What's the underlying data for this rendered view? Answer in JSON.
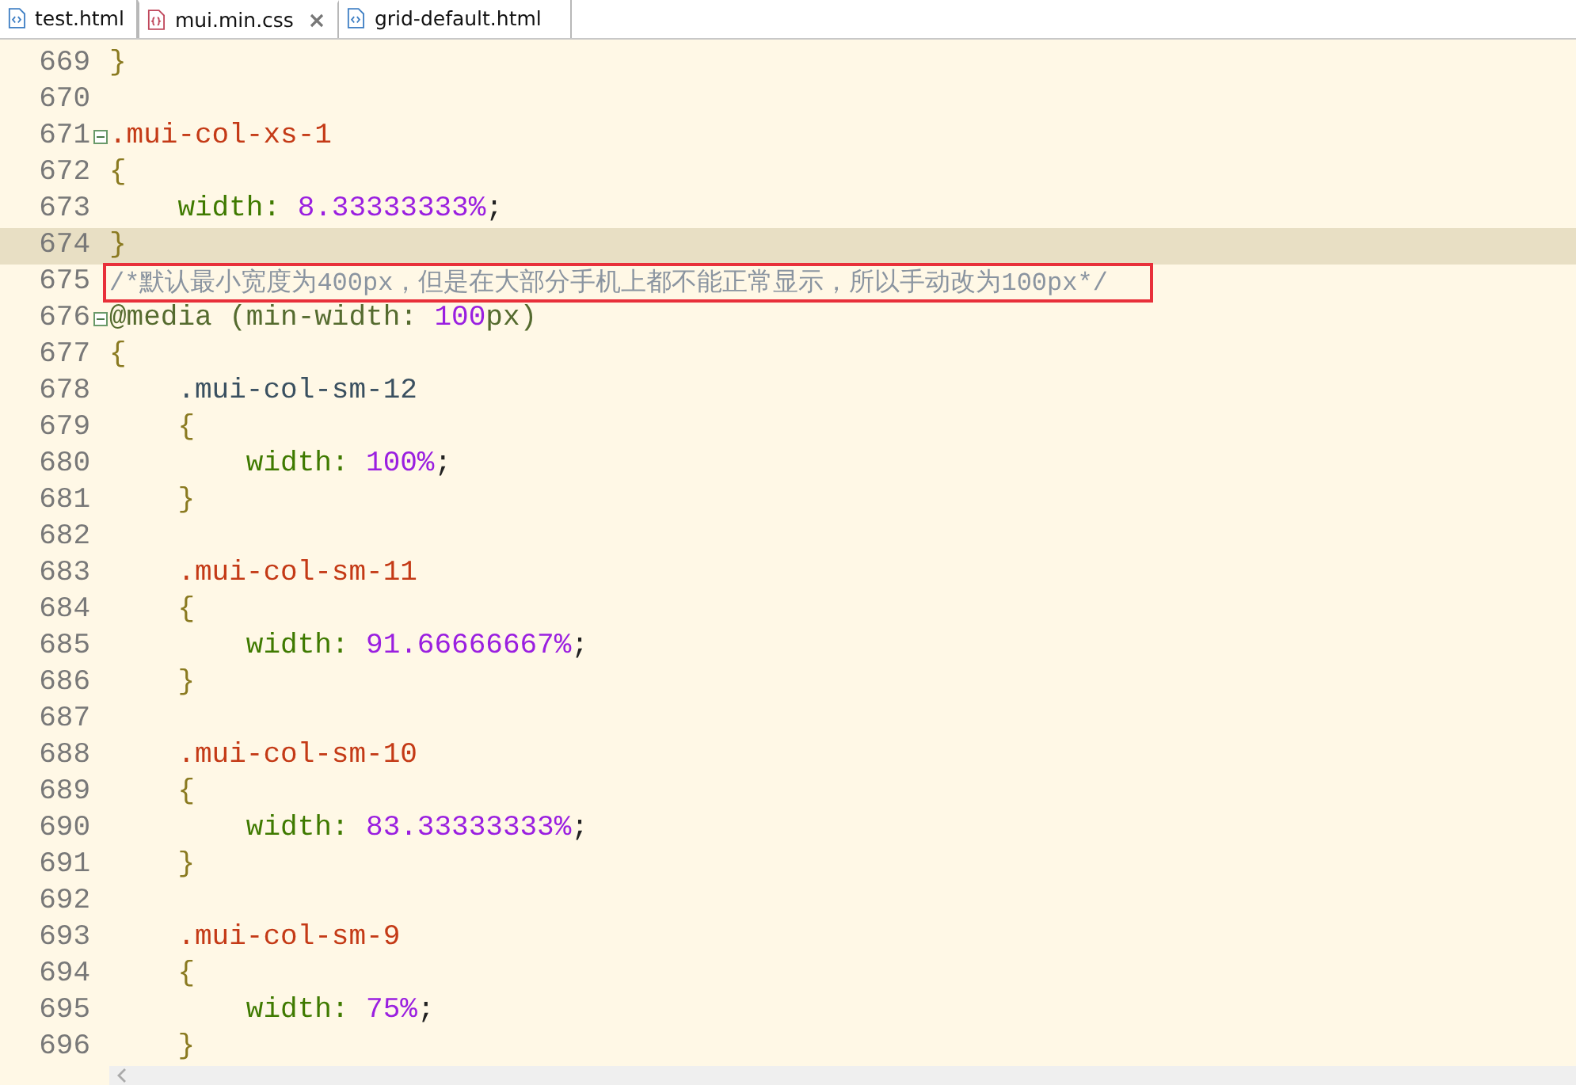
{
  "tabs": [
    {
      "label": "test.html",
      "kind": "html",
      "selected": false,
      "closable": false
    },
    {
      "label": "mui.min.css",
      "kind": "css",
      "selected": true,
      "closable": true
    },
    {
      "label": "grid-default.html",
      "kind": "html",
      "selected": false,
      "closable": false
    }
  ],
  "lines": [
    {
      "number": "669",
      "current": false,
      "fold": false,
      "annotated": false,
      "tokens": [
        {
          "kind": "brace",
          "text": "}"
        }
      ]
    },
    {
      "number": "670",
      "current": false,
      "fold": false,
      "annotated": false
    },
    {
      "number": "671",
      "current": false,
      "fold": true,
      "annotated": false,
      "tokens": [
        {
          "kind": "selector",
          "text": ".mui-col-xs-1"
        }
      ]
    },
    {
      "number": "672",
      "current": false,
      "fold": false,
      "annotated": false,
      "tokens": [
        {
          "kind": "brace",
          "text": "{"
        }
      ]
    },
    {
      "number": "673",
      "current": false,
      "fold": false,
      "annotated": false,
      "tokens": [
        {
          "kind": "property",
          "text": "    width: "
        },
        {
          "kind": "number",
          "text": "8.33333333%"
        },
        {
          "kind": "punct",
          "text": ";"
        }
      ]
    },
    {
      "number": "674",
      "current": true,
      "fold": false,
      "annotated": false,
      "tokens": [
        {
          "kind": "brace",
          "text": "}"
        }
      ]
    },
    {
      "number": "675",
      "current": false,
      "fold": false,
      "annotated": true,
      "tokens": [
        {
          "kind": "comment",
          "text": "/*默认最小宽度为400px，但是在大部分手机上都不能正常显示，所以手动改为100px*/"
        }
      ]
    },
    {
      "number": "676",
      "current": false,
      "fold": true,
      "annotated": false,
      "tokens": [
        {
          "kind": "keyword",
          "text": "@media (min-width: "
        },
        {
          "kind": "number",
          "text": "100"
        },
        {
          "kind": "keyword",
          "text": "px)"
        }
      ]
    },
    {
      "number": "677",
      "current": false,
      "fold": false,
      "annotated": false,
      "tokens": [
        {
          "kind": "brace",
          "text": "{"
        }
      ]
    },
    {
      "number": "678",
      "current": false,
      "fold": false,
      "annotated": false,
      "tokens": [
        {
          "kind": "selector2",
          "text": "    .mui-col-sm-12"
        }
      ]
    },
    {
      "number": "679",
      "current": false,
      "fold": false,
      "annotated": false,
      "tokens": [
        {
          "kind": "brace",
          "text": "    {"
        }
      ]
    },
    {
      "number": "680",
      "current": false,
      "fold": false,
      "annotated": false,
      "tokens": [
        {
          "kind": "property",
          "text": "        width: "
        },
        {
          "kind": "number",
          "text": "100%"
        },
        {
          "kind": "punct",
          "text": ";"
        }
      ]
    },
    {
      "number": "681",
      "current": false,
      "fold": false,
      "annotated": false,
      "tokens": [
        {
          "kind": "brace",
          "text": "    }"
        }
      ]
    },
    {
      "number": "682",
      "current": false,
      "fold": false,
      "annotated": false
    },
    {
      "number": "683",
      "current": false,
      "fold": false,
      "annotated": false,
      "tokens": [
        {
          "kind": "selector",
          "text": "    .mui-col-sm-11"
        }
      ]
    },
    {
      "number": "684",
      "current": false,
      "fold": false,
      "annotated": false,
      "tokens": [
        {
          "kind": "brace",
          "text": "    {"
        }
      ]
    },
    {
      "number": "685",
      "current": false,
      "fold": false,
      "annotated": false,
      "tokens": [
        {
          "kind": "property",
          "text": "        width: "
        },
        {
          "kind": "number",
          "text": "91.66666667%"
        },
        {
          "kind": "punct",
          "text": ";"
        }
      ]
    },
    {
      "number": "686",
      "current": false,
      "fold": false,
      "annotated": false,
      "tokens": [
        {
          "kind": "brace",
          "text": "    }"
        }
      ]
    },
    {
      "number": "687",
      "current": false,
      "fold": false,
      "annotated": false
    },
    {
      "number": "688",
      "current": false,
      "fold": false,
      "annotated": false,
      "tokens": [
        {
          "kind": "selector",
          "text": "    .mui-col-sm-10"
        }
      ]
    },
    {
      "number": "689",
      "current": false,
      "fold": false,
      "annotated": false,
      "tokens": [
        {
          "kind": "brace",
          "text": "    {"
        }
      ]
    },
    {
      "number": "690",
      "current": false,
      "fold": false,
      "annotated": false,
      "tokens": [
        {
          "kind": "property",
          "text": "        width: "
        },
        {
          "kind": "number",
          "text": "83.33333333%"
        },
        {
          "kind": "punct",
          "text": ";"
        }
      ]
    },
    {
      "number": "691",
      "current": false,
      "fold": false,
      "annotated": false,
      "tokens": [
        {
          "kind": "brace",
          "text": "    }"
        }
      ]
    },
    {
      "number": "692",
      "current": false,
      "fold": false,
      "annotated": false
    },
    {
      "number": "693",
      "current": false,
      "fold": false,
      "annotated": false,
      "tokens": [
        {
          "kind": "selector",
          "text": "    .mui-col-sm-9"
        }
      ]
    },
    {
      "number": "694",
      "current": false,
      "fold": false,
      "annotated": false,
      "tokens": [
        {
          "kind": "brace",
          "text": "    {"
        }
      ]
    },
    {
      "number": "695",
      "current": false,
      "fold": false,
      "annotated": false,
      "tokens": [
        {
          "kind": "property",
          "text": "        width: "
        },
        {
          "kind": "number",
          "text": "75%"
        },
        {
          "kind": "punct",
          "text": ";"
        }
      ]
    },
    {
      "number": "696",
      "current": false,
      "fold": false,
      "annotated": false,
      "tokens": [
        {
          "kind": "brace",
          "text": "    }"
        }
      ]
    }
  ]
}
